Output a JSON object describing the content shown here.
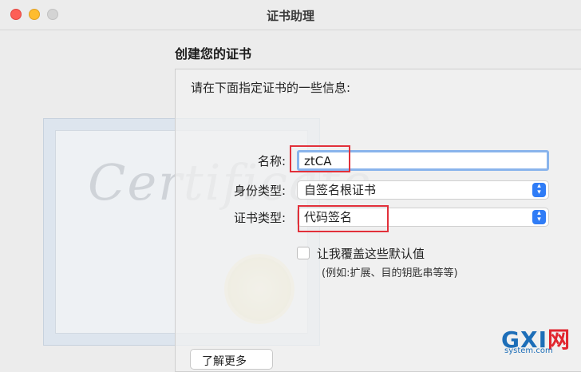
{
  "window": {
    "title": "证书助理"
  },
  "heading": "创建您的证书",
  "form": {
    "prompt": "请在下面指定证书的一些信息:",
    "name_label": "名称:",
    "name_value": "ztCA",
    "identity_label": "身份类型:",
    "identity_value": "自签名根证书",
    "cert_type_label": "证书类型:",
    "cert_type_value": "代码签名",
    "override_label": "让我覆盖这些默认值",
    "override_hint": "(例如:扩展、目的钥匙串等等)",
    "learn_more_label": "了解更多"
  },
  "illustration": {
    "script_text": "Certificate"
  },
  "watermark": {
    "logo": "GXI网",
    "site": "system.com"
  },
  "colors": {
    "highlight_box": "#e2303a",
    "focus_ring": "#89b4ec",
    "select_accent": "#2f7cf6"
  }
}
